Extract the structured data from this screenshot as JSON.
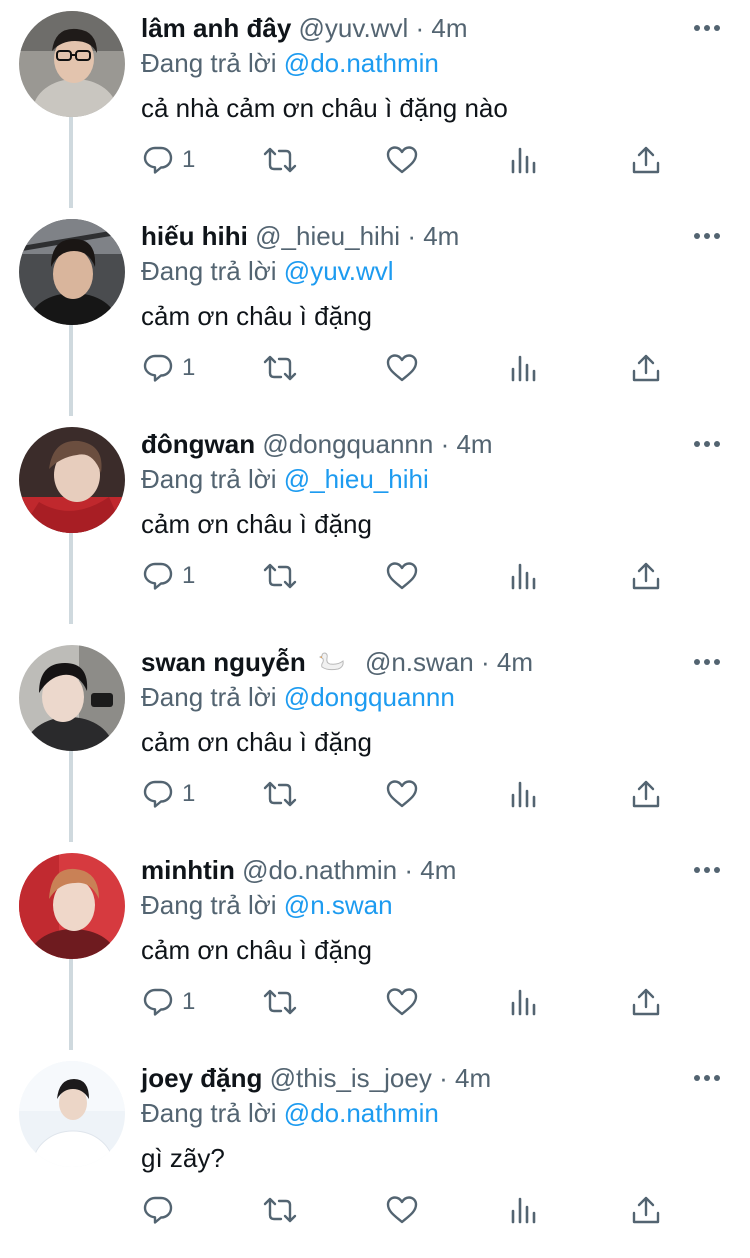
{
  "reply_prefix": "Đang trả lời",
  "icons": {
    "reply": "reply-icon",
    "retweet": "retweet-icon",
    "like": "heart-icon",
    "views": "analytics-icon",
    "share": "share-icon",
    "more": "more-dots-icon"
  },
  "colors": {
    "mention": "#1d9bf0",
    "secondary_text": "#536471",
    "thread_line": "#cfd9de"
  },
  "tweets": [
    {
      "name": "lâm anh đây",
      "handle": "@yuv.wvl",
      "time": "4m",
      "reply_to": "@do.nathmin",
      "text": "cả nhà cảm ơn châu ì đặng nào",
      "reply_count": "1"
    },
    {
      "name": "hiếu hihi",
      "handle": "@_hieu_hihi",
      "time": "4m",
      "reply_to": "@yuv.wvl",
      "text": "cảm ơn châu ì đặng",
      "reply_count": "1"
    },
    {
      "name": "đôngwan",
      "handle": "@dongquannn",
      "time": "4m",
      "reply_to": "@_hieu_hihi",
      "text": "cảm ơn châu ì đặng",
      "reply_count": "1"
    },
    {
      "name": "swan nguyễn",
      "name_emoji": "swan-emoji",
      "handle": "@n.swan",
      "time": "4m",
      "reply_to": "@dongquannn",
      "text": "cảm ơn châu ì đặng",
      "reply_count": "1"
    },
    {
      "name": "minhtin",
      "handle": "@do.nathmin",
      "time": "4m",
      "reply_to": "@n.swan",
      "text": "cảm ơn châu ì đặng",
      "reply_count": "1"
    },
    {
      "name": "joey đặng",
      "handle": "@this_is_joey",
      "time": "4m",
      "reply_to": "@do.nathmin",
      "text": "gì zãy?",
      "reply_count": ""
    }
  ]
}
